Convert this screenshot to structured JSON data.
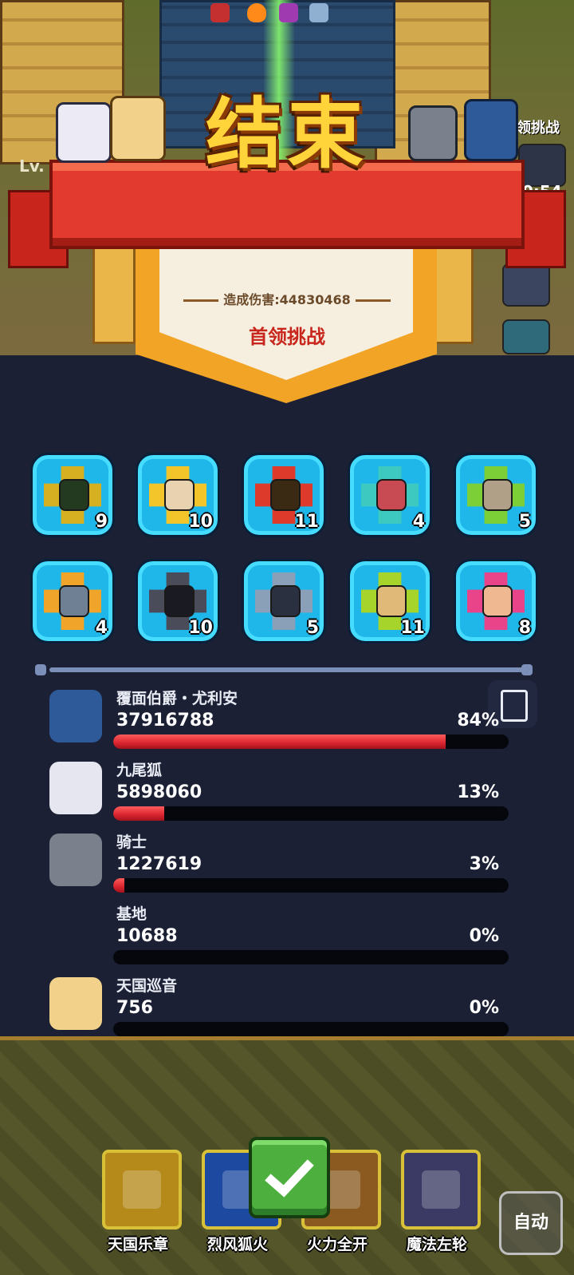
{
  "scene": {
    "level_prefix": "Lv.",
    "boss_tag_partial": "领挑战",
    "timer_partial": "0:54",
    "top_icons": [
      "cross-icon",
      "fire-icon",
      "skull-icon",
      "lightning-icon"
    ]
  },
  "result": {
    "title": "结束",
    "damage_text": "造成伤害:44830468",
    "mode": "首领挑战"
  },
  "tiles": [
    {
      "level": "9",
      "color": "#d6b020",
      "face": "#243a20"
    },
    {
      "level": "10",
      "color": "#f3c52a",
      "face": "#e8d2b0"
    },
    {
      "level": "11",
      "color": "#dd3a2c",
      "face": "#3a2a14"
    },
    {
      "level": "4",
      "color": "#3ec9c0",
      "face": "#c84a52"
    },
    {
      "level": "5",
      "color": "#7dcf38",
      "face": "#b0a088"
    },
    {
      "level": "4",
      "color": "#f0a42a",
      "face": "#708094"
    },
    {
      "level": "10",
      "color": "#4a4c5a",
      "face": "#1a1b22"
    },
    {
      "level": "5",
      "color": "#8aa0b8",
      "face": "#2a3040"
    },
    {
      "level": "11",
      "color": "#a6d42a",
      "face": "#e0b878"
    },
    {
      "level": "8",
      "color": "#e9448a",
      "face": "#f0b890"
    }
  ],
  "damage_list": [
    {
      "name": "覆面伯爵・尤利安",
      "value": "37916788",
      "percent": "84%",
      "fraction": 0.84,
      "avatar_color": "#2e5a9a"
    },
    {
      "name": "九尾狐",
      "value": "5898060",
      "percent": "13%",
      "fraction": 0.13,
      "avatar_color": "#e6e6f0"
    },
    {
      "name": "骑士",
      "value": "1227619",
      "percent": "3%",
      "fraction": 0.03,
      "avatar_color": "#7a808c"
    },
    {
      "name": "基地",
      "value": "10688",
      "percent": "0%",
      "fraction": 0.0,
      "avatar_color": ""
    },
    {
      "name": "天国巡音",
      "value": "756",
      "percent": "0%",
      "fraction": 0.0,
      "avatar_color": "#f2d28a"
    }
  ],
  "skills": [
    {
      "label": "天国乐章",
      "icon": "harp-icon",
      "color": "#b58a1a"
    },
    {
      "label": "烈风狐火",
      "icon": "tornado-icon",
      "color": "#1d4aa0"
    },
    {
      "label": "火力全开",
      "icon": "cannon-icon",
      "color": "#8a5a20"
    },
    {
      "label": "魔法左轮",
      "icon": "revolver-icon",
      "color": "#3a3a64"
    }
  ],
  "auto_label": "自动",
  "colors": {
    "panel_bg": "#1b2035",
    "tile_border": "#1fb7ea",
    "bar_fill": "#d8242f",
    "title_gold": "#ffd43a",
    "ribbon_red": "#e23a2e"
  }
}
